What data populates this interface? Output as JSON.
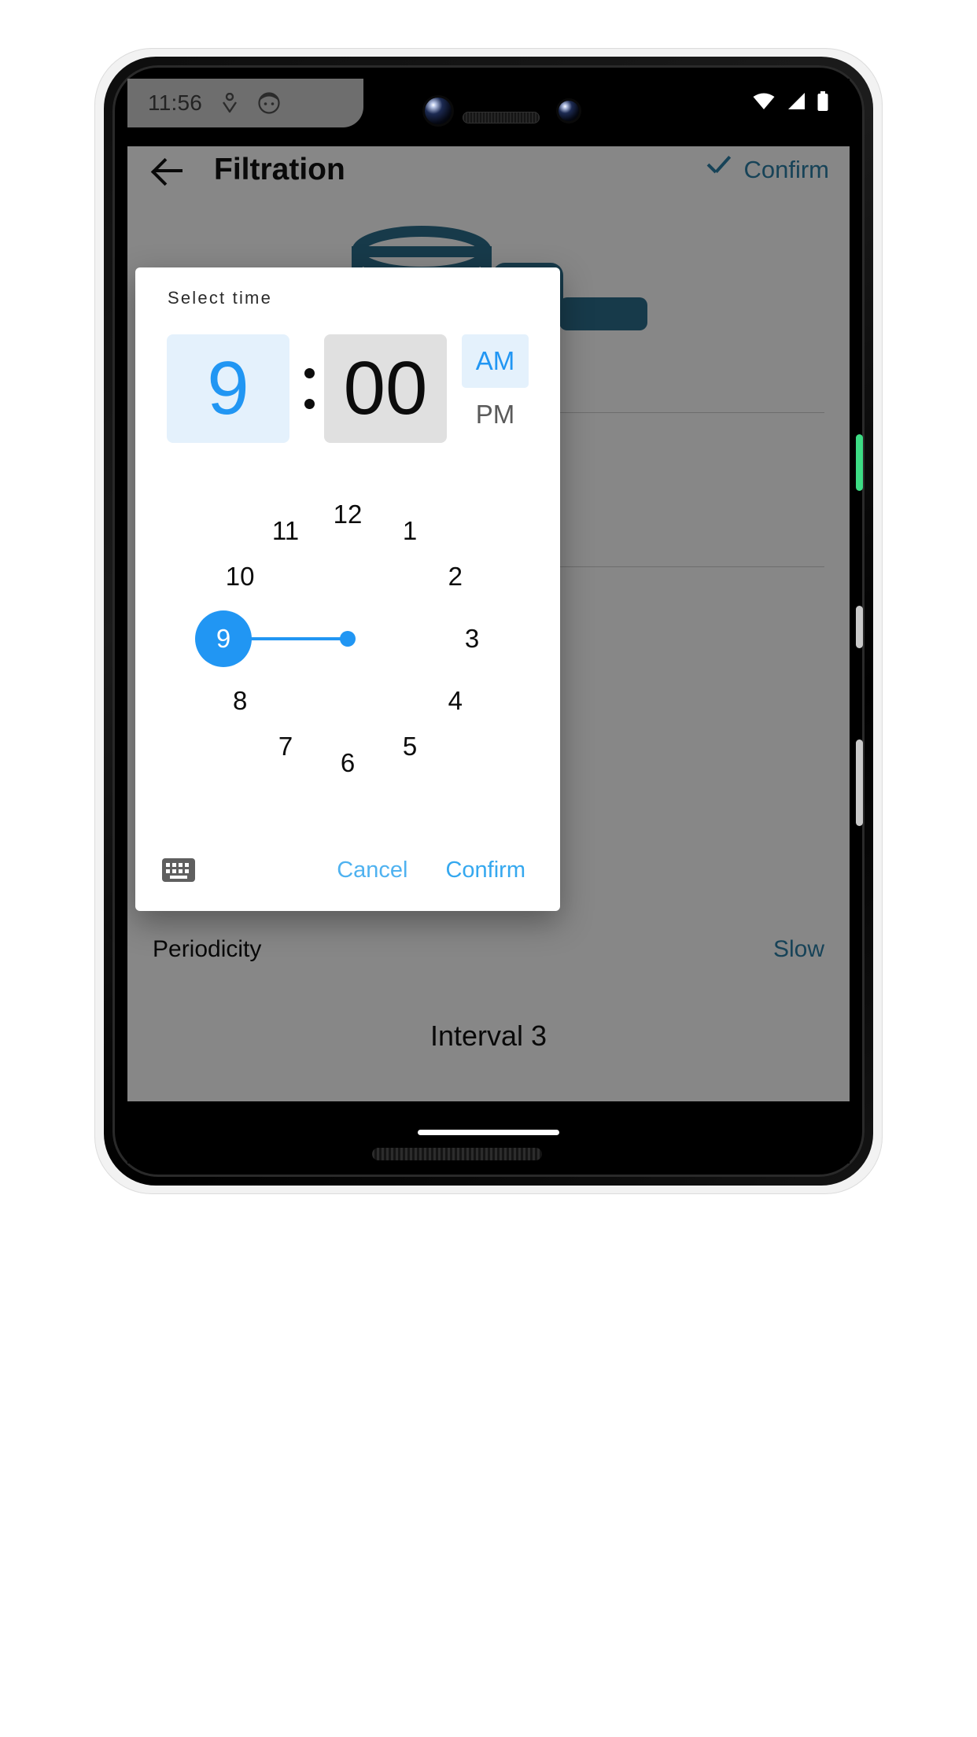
{
  "status_bar": {
    "time": "11:56",
    "left_icons": [
      "footprint-icon",
      "face-avatar-icon"
    ],
    "right_icons": [
      "wifi-icon",
      "cellular-signal-icon",
      "battery-icon"
    ]
  },
  "app": {
    "back_icon": "back-arrow-icon",
    "title": "Filtration",
    "confirm_label": "Confirm",
    "confirm_icon": "check-icon",
    "accent_color": "#2d7fa6",
    "rows": [
      {
        "label": "Periodicity",
        "value": "Slow"
      }
    ],
    "section_title": "Interval 3"
  },
  "dialog": {
    "title": "Select time",
    "hour": "9",
    "minute": "00",
    "separator": ":",
    "meridiem_options": [
      "AM",
      "PM"
    ],
    "meridiem_selected": "AM",
    "selected_field": "hour",
    "selected_hour_value": 9,
    "clock_numbers": [
      "12",
      "1",
      "2",
      "3",
      "4",
      "5",
      "6",
      "7",
      "8",
      "9",
      "10",
      "11"
    ],
    "keyboard_icon": "keyboard-icon",
    "cancel_label": "Cancel",
    "confirm_label": "Confirm",
    "accent_color": "#2196f3",
    "selected_bg_color": "#e4f1fc",
    "minute_bg_color": "#e0e0e0"
  },
  "device": {
    "nav_pill": "home-indicator"
  }
}
